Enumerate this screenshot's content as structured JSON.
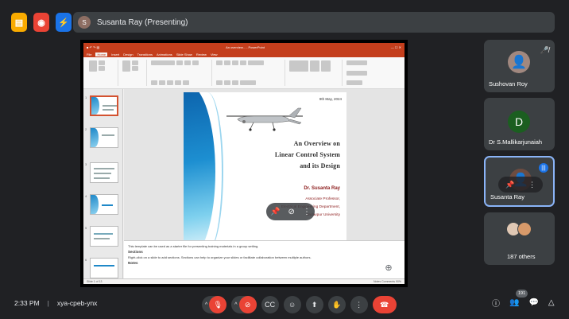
{
  "presenter": {
    "banner": "Susanta Ray (Presenting)"
  },
  "ppt": {
    "title_bar": "An overview... - PowerPoint",
    "tabs": [
      "File",
      "Home",
      "Insert",
      "Design",
      "Transitions",
      "Animations",
      "Slide Show",
      "Review",
      "View"
    ],
    "slide": {
      "date": "9th May, 2024",
      "title_line1": "An Overview on",
      "title_line2": "Linear Control System",
      "title_line3": "and its Design",
      "author": "Dr. Susanta Ray",
      "aff1": "Associate Professor,",
      "aff2": "Electrical Engineering Department,",
      "aff3": "Jadavpur University"
    },
    "notes": {
      "line1": "This template can be used as a starter file for presenting training materials in a group setting.",
      "heading": "Sections",
      "line2": "Right-click on a slide to add sections. Sections can help to organize your slides or facilitate collaboration between multiple authors.",
      "heading2": "Notes"
    },
    "status_left": "Slide 1 of 13",
    "status_right": "Notes   Comments   90%"
  },
  "participants": [
    {
      "name": "Sushovan Roy"
    },
    {
      "name": "Dr S.Mallikarjunaiah",
      "initial": "D"
    },
    {
      "name": "Susanta Ray"
    },
    {
      "name": "187 others"
    }
  ],
  "meeting": {
    "time": "2:33 PM",
    "code": "xya-cpeb-ynx",
    "people_count": "191"
  },
  "colors": {
    "bg": "#202124",
    "tile": "#3c4043",
    "red": "#ea4335",
    "blue": "#1a73e8"
  }
}
